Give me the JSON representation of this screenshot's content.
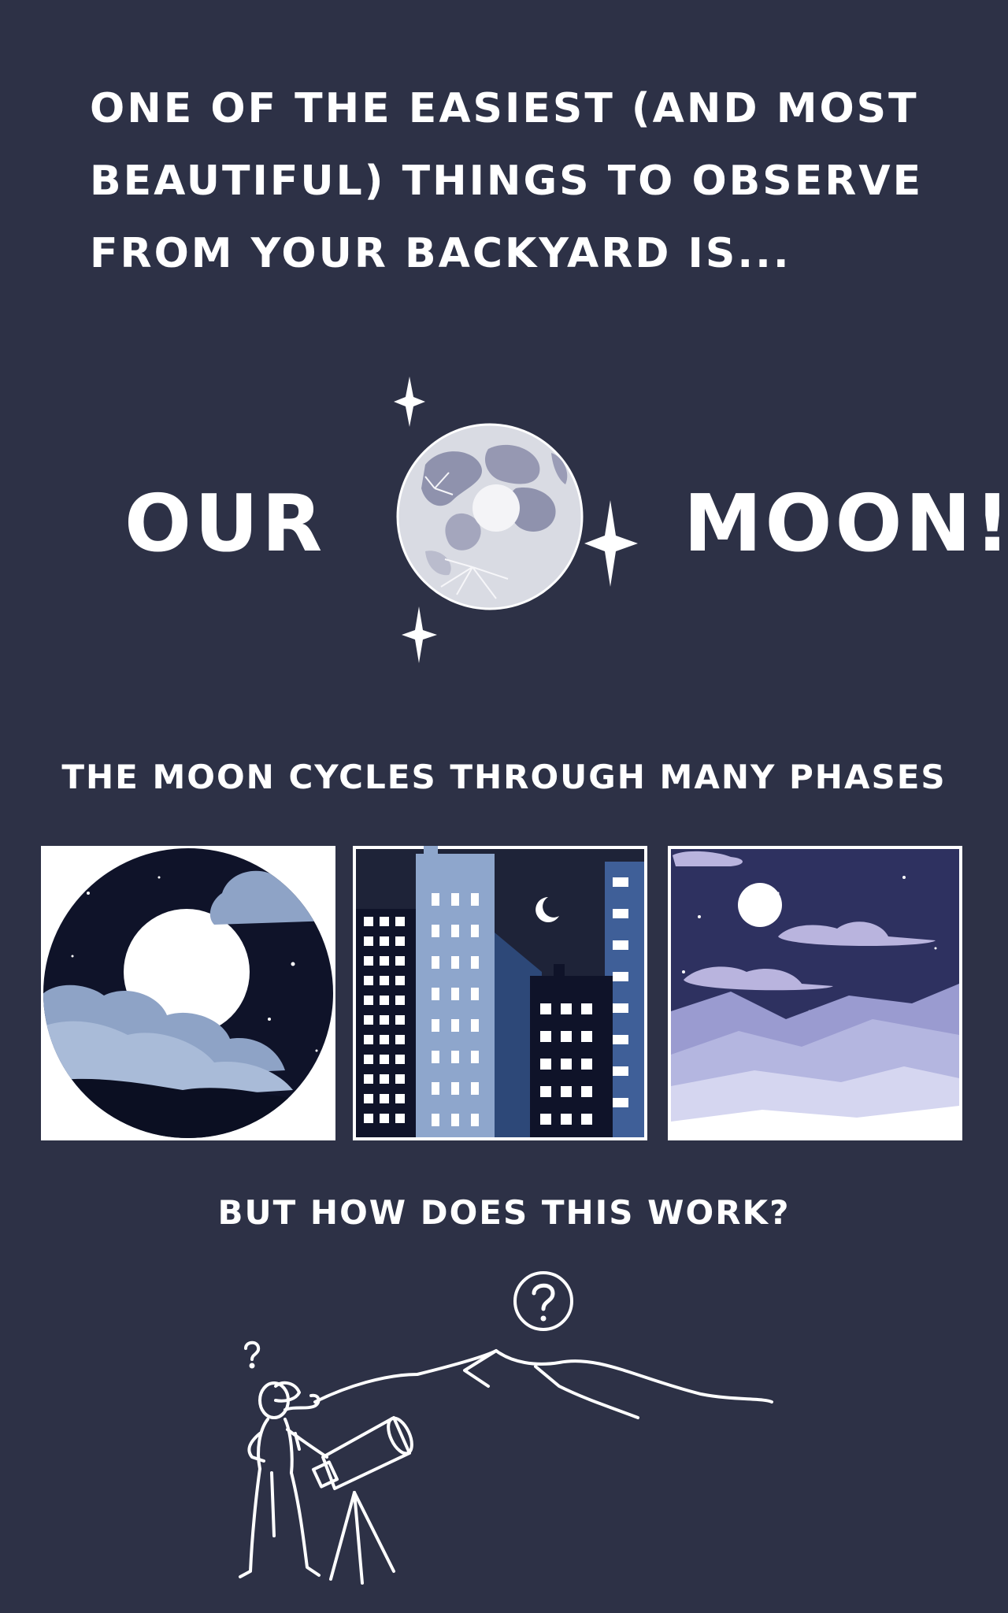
{
  "intro": {
    "lines": [
      "ONE OF THE EASIEST (AND MOST",
      "BEAUTIFUL) THINGS TO OBSERVE",
      "FROM YOUR BACKYARD IS..."
    ]
  },
  "headline": {
    "word_left": "OUR",
    "word_right": "MOON!"
  },
  "phases_caption": "THE MOON CYCLES THROUGH MANY PHASES",
  "panels": [
    {
      "scene": "full moon behind clouds"
    },
    {
      "scene": "crescent moon over city buildings"
    },
    {
      "scene": "full moon over purple mountains"
    }
  ],
  "question": "BUT HOW DOES THIS WORK?",
  "colors": {
    "background": "#2d3146",
    "text": "#ffffff",
    "night_sky": "#0f1329",
    "cloud_blue": "#a2b3d1",
    "building_light": "#8ea6cc",
    "mountain_purple": "#9a9bd0"
  }
}
